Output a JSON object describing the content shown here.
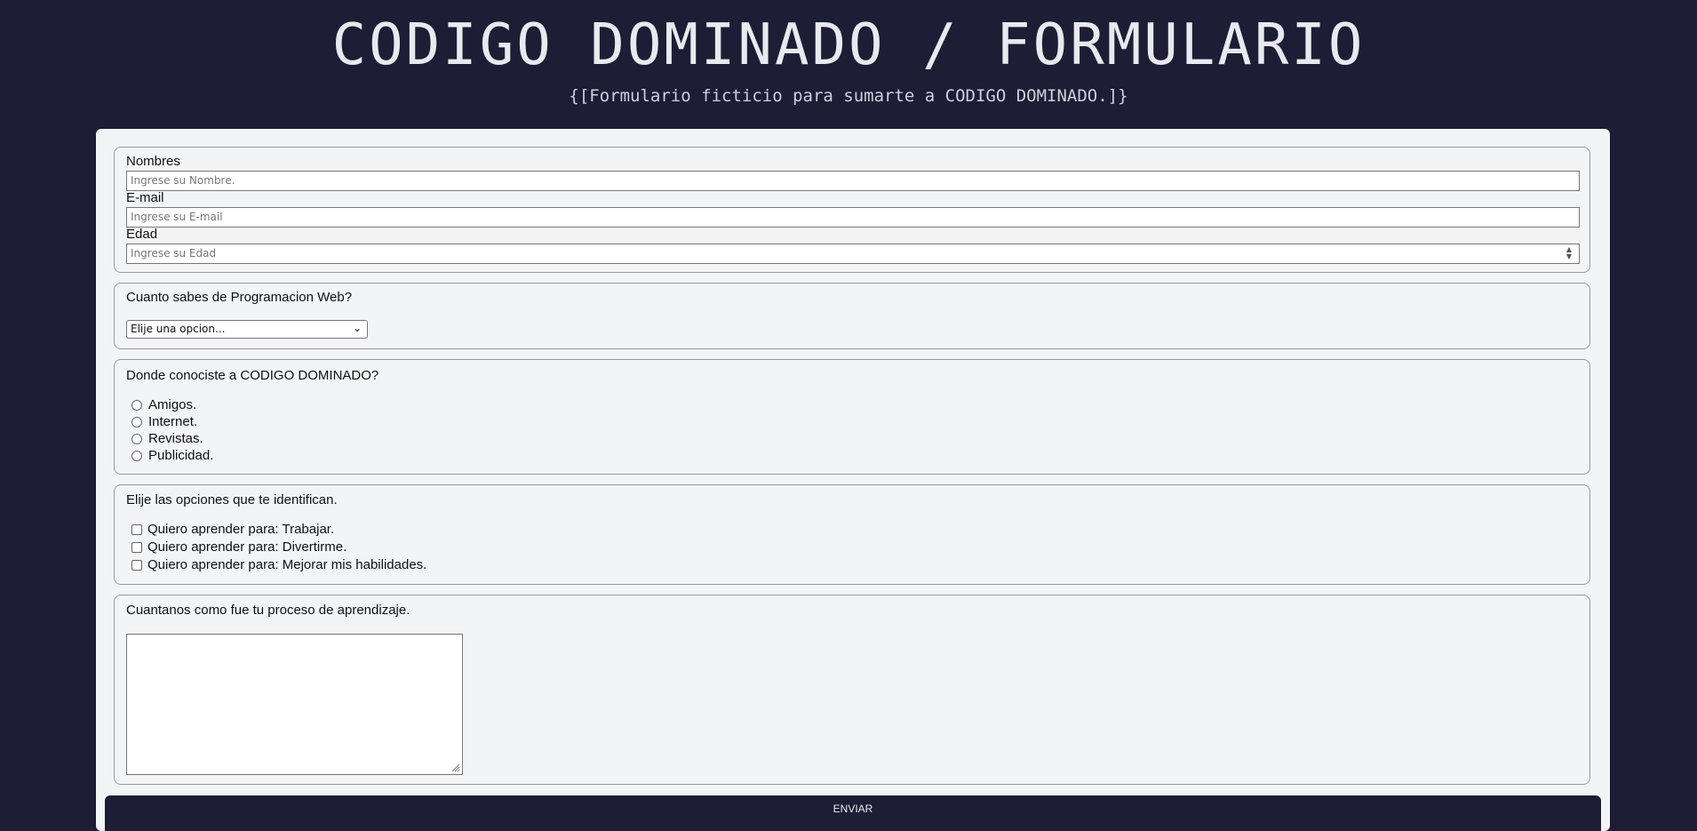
{
  "header": {
    "title": "CODIGO DOMINADO / FORMULARIO",
    "subtitle": "{[Formulario ficticio para sumarte a CODIGO DOMINADO.]}"
  },
  "personal": {
    "name_label": "Nombres",
    "name_placeholder": "Ingrese su Nombre.",
    "email_label": "E-mail",
    "email_placeholder": "Ingrese su E-mail",
    "age_label": "Edad",
    "age_placeholder": "Ingrese su Edad"
  },
  "knowledge": {
    "question": "Cuanto sabes de Programacion Web?",
    "selected": "Elije una opcion..."
  },
  "source": {
    "question": "Donde conociste a CODIGO DOMINADO?",
    "options": [
      "Amigos.",
      "Internet.",
      "Revistas.",
      "Publicidad."
    ]
  },
  "goals": {
    "question": "Elije las opciones que te identifican.",
    "options": [
      "Quiero aprender para: Trabajar.",
      "Quiero aprender para: Divertirme.",
      "Quiero aprender para: Mejorar mis habilidades."
    ]
  },
  "story": {
    "question": "Cuantanos como fue tu proceso de aprendizaje.",
    "value": ""
  },
  "submit": {
    "label": "ENVIAR"
  },
  "colors": {
    "background": "#1d1d35",
    "form": "#f3f4f6",
    "border": "#9a9a9a"
  }
}
